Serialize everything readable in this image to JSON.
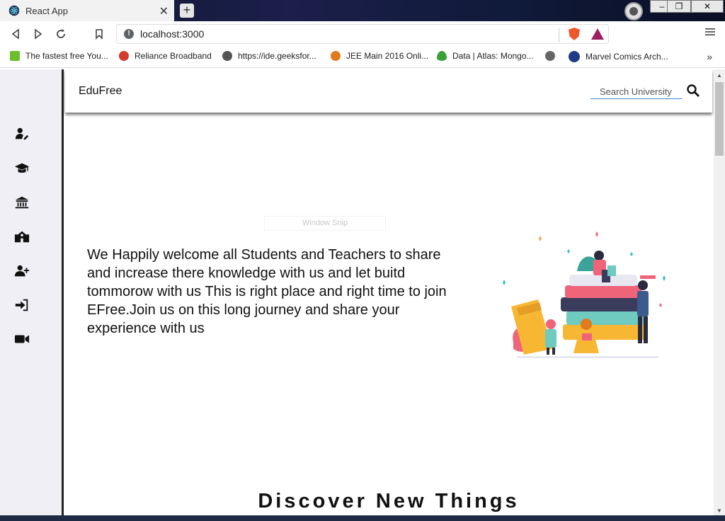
{
  "browser": {
    "tab_title": "React App",
    "tab_close": "✕",
    "new_tab": "+",
    "url": "localhost:3000",
    "window_controls": [
      "–",
      "❐",
      "✕"
    ]
  },
  "bookmarks": [
    {
      "label": "The fastest free You...",
      "icon_color": "#6abf2a"
    },
    {
      "label": "Reliance Broadband",
      "icon_color": "#d43a2f"
    },
    {
      "label": "https://ide.geeksfor...",
      "icon_color": "#555555"
    },
    {
      "label": "JEE Main 2016 Onli...",
      "icon_color": "#e07a1a"
    },
    {
      "label": "Data | Atlas: Mongo...",
      "icon_color": "#3aa03a"
    },
    {
      "label": "",
      "icon_color": "#666666"
    },
    {
      "label": "Marvel Comics Arch...",
      "icon_color": "#1e3a8a"
    }
  ],
  "bookmarks_more": "»",
  "app": {
    "brand": "EduFree",
    "search_placeholder": "Search University",
    "sidebar_icons": [
      "user-edit-icon",
      "graduation-cap-icon",
      "university-icon",
      "school-icon",
      "user-plus-icon",
      "sign-in-icon",
      "video-icon"
    ],
    "welcome_text": "We Happily welcome all Students and Teachers to share and increase there knowledge with us and let buitd tommorow with us This is right place and right time to join EFree.Join us on this long journey and share your experience with us",
    "section_heading": "Discover New Things",
    "snip_label": "Window Snip"
  },
  "colors": {
    "sidebar_bg": "#f0eff5",
    "search_underline": "#3a8bd2",
    "brave_orange": "#f1562b"
  }
}
